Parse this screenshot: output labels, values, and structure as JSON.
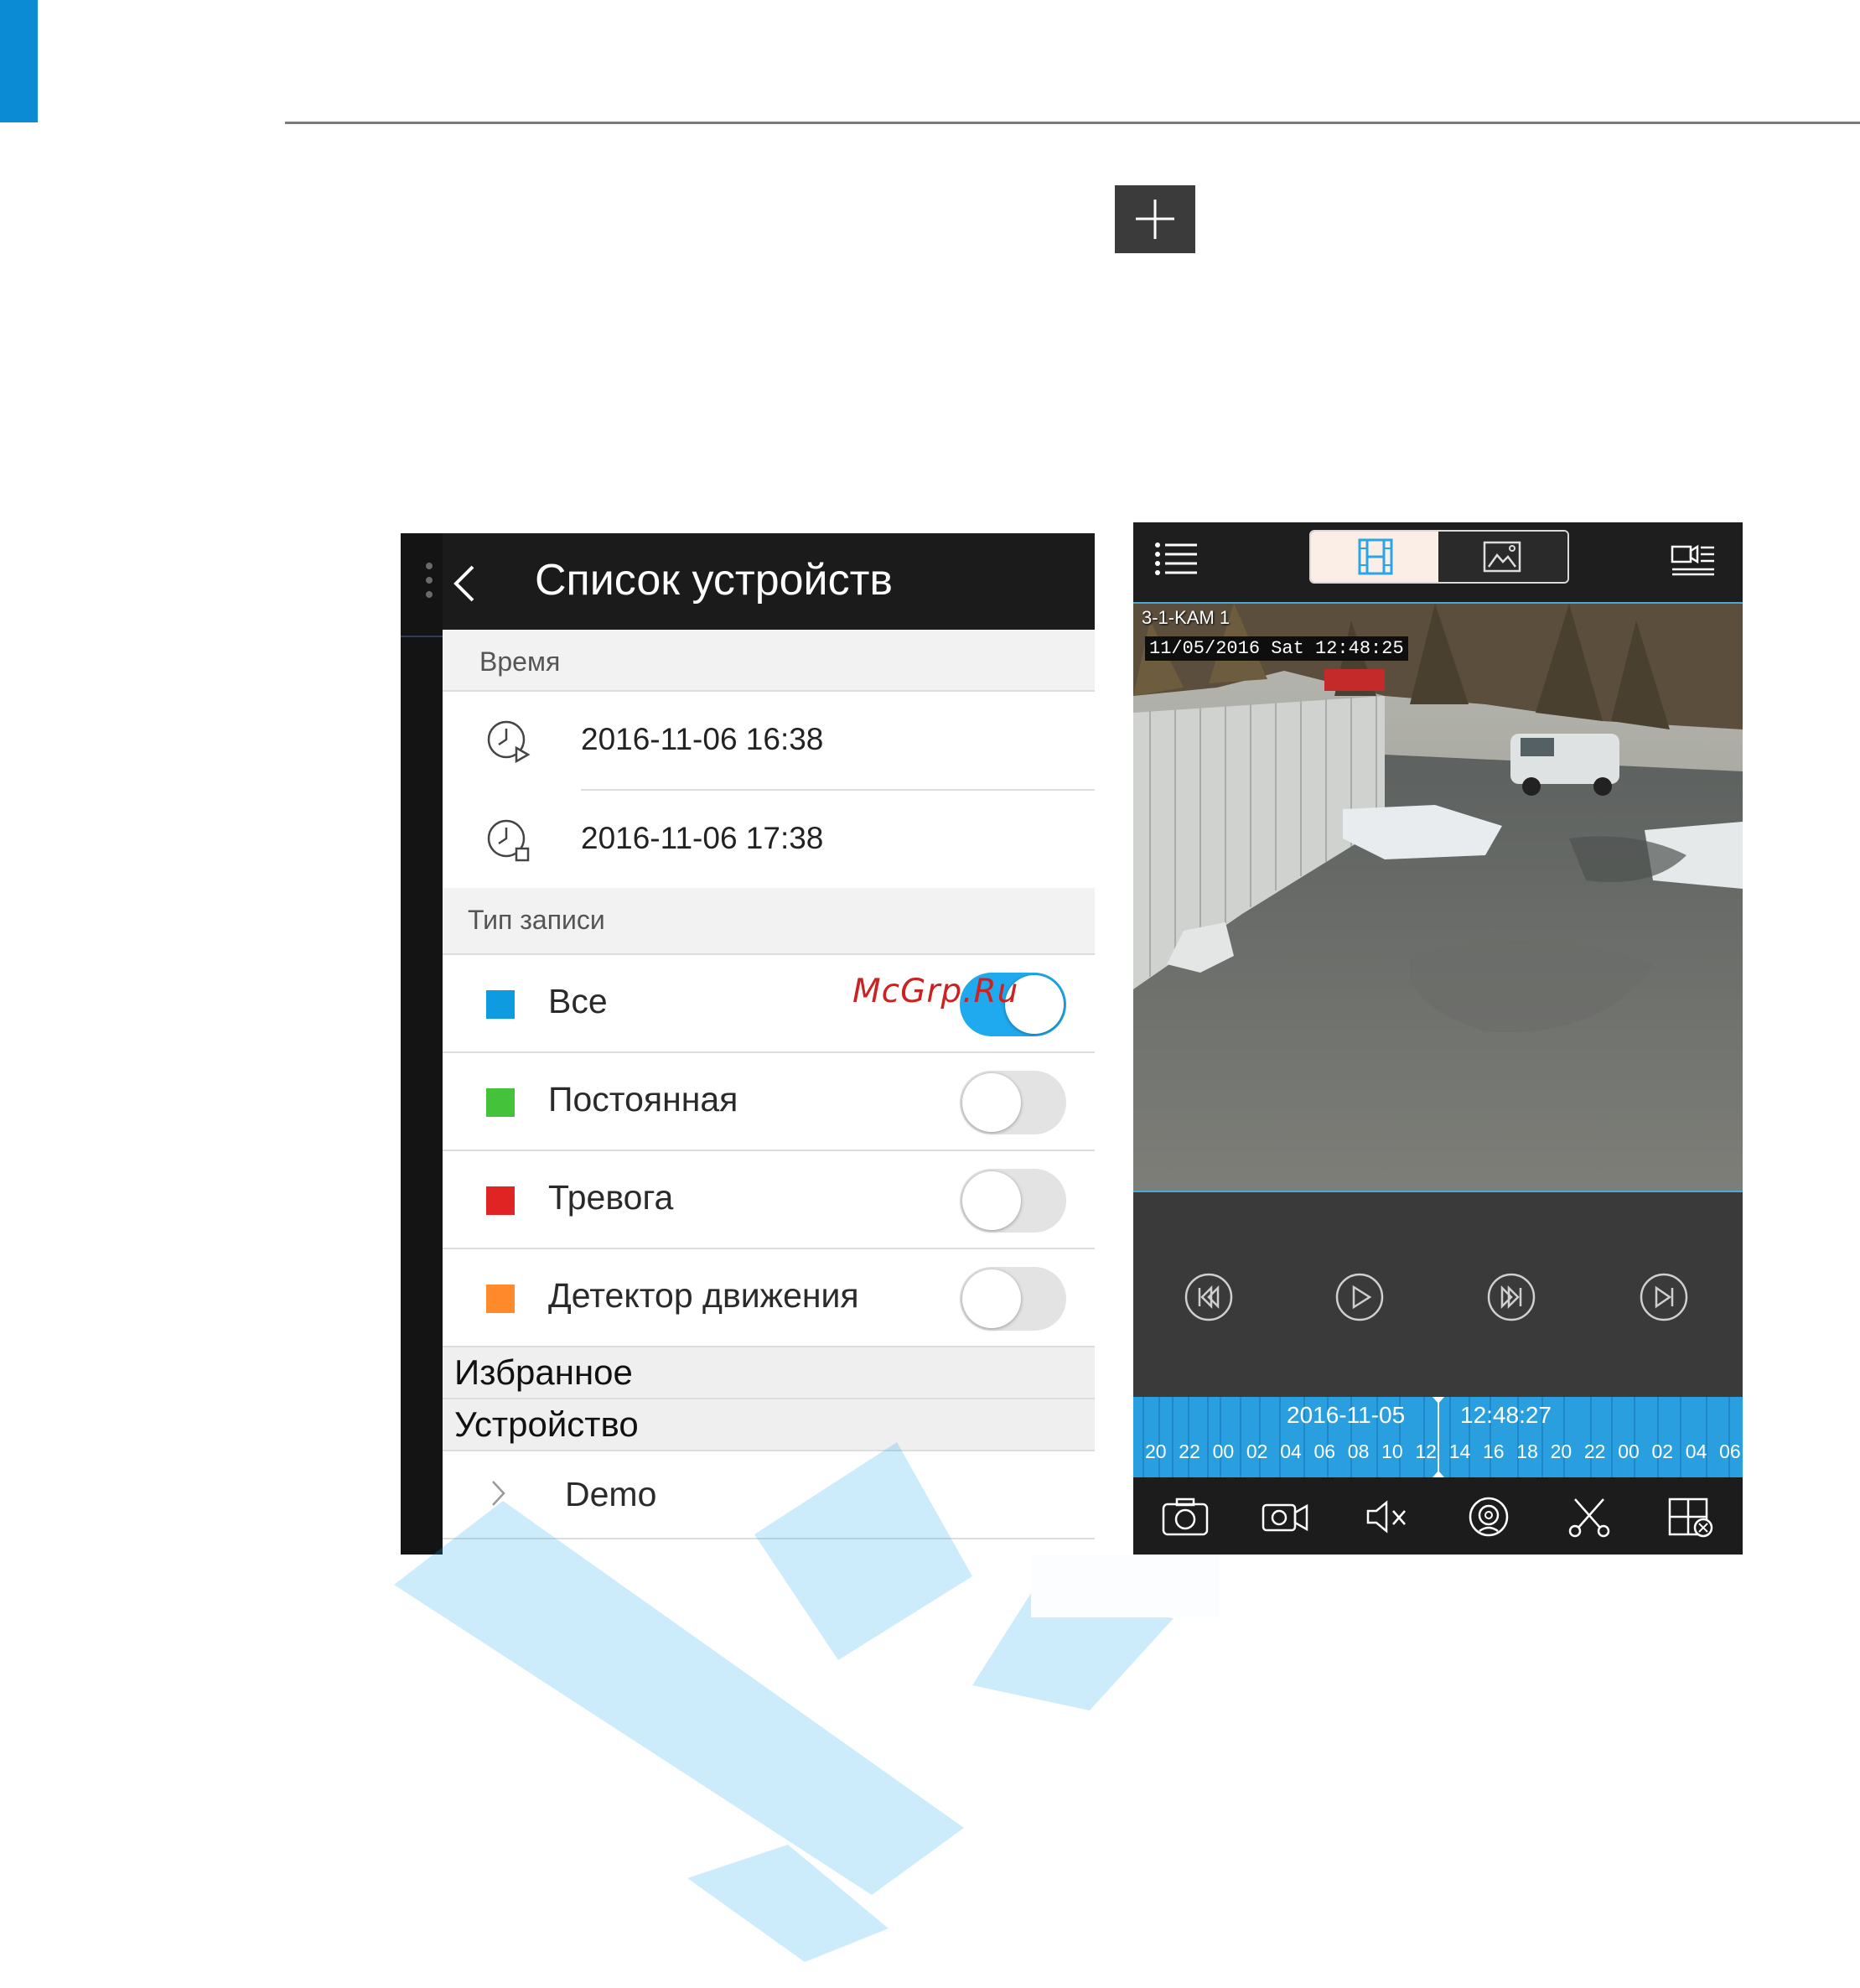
{
  "page": {
    "accent_color": "#0a8bd4",
    "plus_icon": "plus-icon"
  },
  "device_list": {
    "title": "Список устройств",
    "back_icon": "chevron-left-icon",
    "time_section": {
      "label": "Время",
      "start": "2016-11-06 16:38",
      "end": "2016-11-06 17:38",
      "start_icon": "clock-play-icon",
      "end_icon": "clock-stop-icon"
    },
    "record_type_section": {
      "label": "Тип записи",
      "items": [
        {
          "label": "Все",
          "color": "#0e9be0",
          "enabled": true
        },
        {
          "label": "Постоянная",
          "color": "#43c23a",
          "enabled": false
        },
        {
          "label": "Тревога",
          "color": "#e02424",
          "enabled": false
        },
        {
          "label": "Детектор движения",
          "color": "#ff8a2b",
          "enabled": false
        }
      ]
    },
    "favorites_label": "Избранное",
    "device_label": "Устройство",
    "devices": [
      {
        "name": "Demo"
      }
    ]
  },
  "watermark": "McGrp.Ru",
  "playback": {
    "osd_camera": "3-1-KAM 1",
    "osd_timestamp": "11/05/2016 Sat 12:48:25",
    "timeline_date": "2016-11-05",
    "timeline_time": "12:48:27",
    "timeline_hours": [
      "20",
      "22",
      "00",
      "02",
      "04",
      "06",
      "08",
      "10",
      "12",
      "14",
      "16",
      "18",
      "20",
      "22",
      "00",
      "02",
      "04",
      "06"
    ],
    "top_icons": [
      "list-menu-icon",
      "film-strip-icon",
      "image-icon",
      "camera-list-icon"
    ],
    "control_icons": [
      "rewind-icon",
      "play-icon",
      "fast-forward-icon",
      "next-frame-icon"
    ],
    "bottom_icons": [
      "camera-snapshot-icon",
      "video-record-icon",
      "mute-icon",
      "ptz-icon",
      "scissors-icon",
      "close-window-icon"
    ]
  }
}
